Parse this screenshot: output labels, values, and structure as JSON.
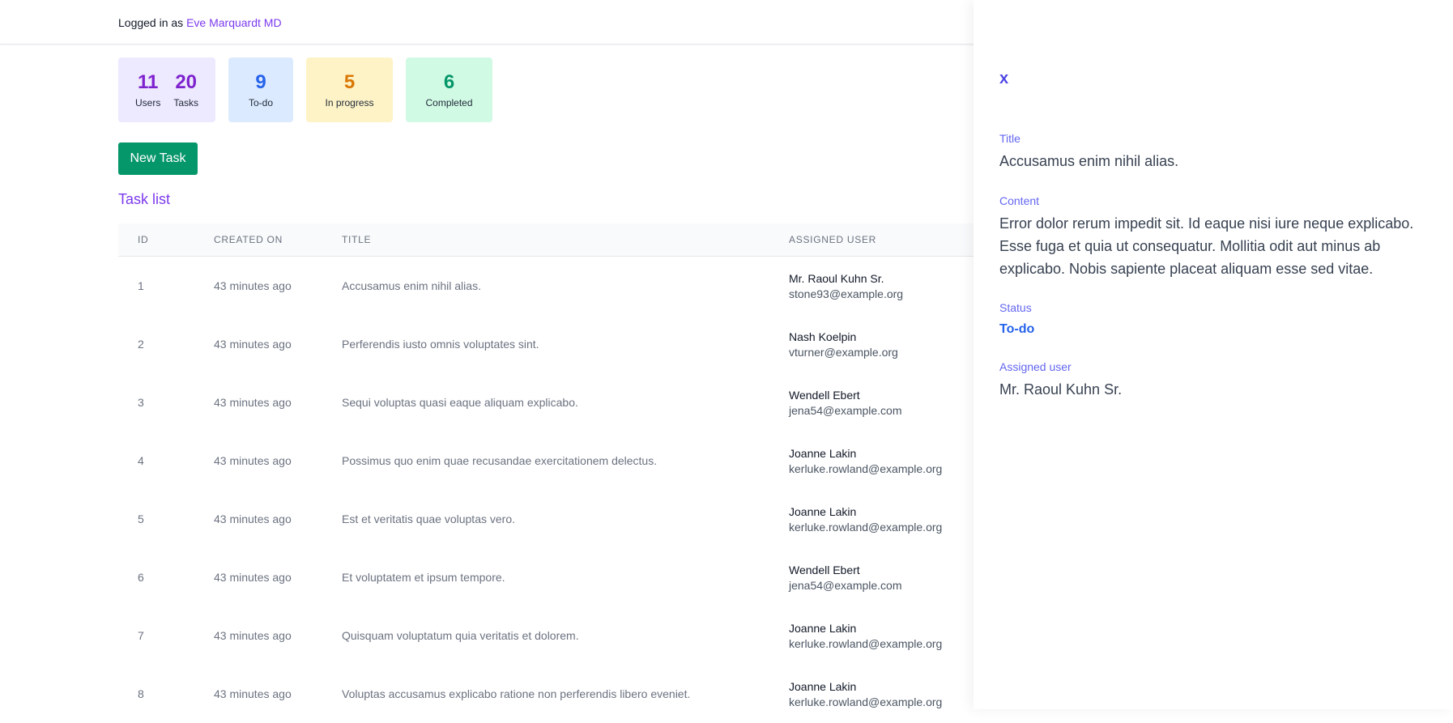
{
  "header": {
    "logged_in_prefix": "Logged in as ",
    "user_name": "Eve Marquardt MD"
  },
  "stats": {
    "users": {
      "value": "11",
      "label": "Users"
    },
    "tasks": {
      "value": "20",
      "label": "Tasks"
    },
    "todo": {
      "value": "9",
      "label": "To-do"
    },
    "in_progress": {
      "value": "5",
      "label": "In progress"
    },
    "completed": {
      "value": "6",
      "label": "Completed"
    }
  },
  "new_task_label": "New Task",
  "task_list_title": "Task list",
  "table": {
    "columns": [
      "ID",
      "CREATED ON",
      "TITLE",
      "ASSIGNED USER"
    ],
    "rows": [
      {
        "id": "1",
        "created": "43 minutes ago",
        "title": "Accusamus enim nihil alias.",
        "user_name": "Mr. Raoul Kuhn Sr.",
        "user_email": "stone93@example.org"
      },
      {
        "id": "2",
        "created": "43 minutes ago",
        "title": "Perferendis iusto omnis voluptates sint.",
        "user_name": "Nash Koelpin",
        "user_email": "vturner@example.org"
      },
      {
        "id": "3",
        "created": "43 minutes ago",
        "title": "Sequi voluptas quasi eaque aliquam explicabo.",
        "user_name": "Wendell Ebert",
        "user_email": "jena54@example.com"
      },
      {
        "id": "4",
        "created": "43 minutes ago",
        "title": "Possimus quo enim quae recusandae exercitationem delectus.",
        "user_name": "Joanne Lakin",
        "user_email": "kerluke.rowland@example.org"
      },
      {
        "id": "5",
        "created": "43 minutes ago",
        "title": "Est et veritatis quae voluptas vero.",
        "user_name": "Joanne Lakin",
        "user_email": "kerluke.rowland@example.org"
      },
      {
        "id": "6",
        "created": "43 minutes ago",
        "title": "Et voluptatem et ipsum tempore.",
        "user_name": "Wendell Ebert",
        "user_email": "jena54@example.com"
      },
      {
        "id": "7",
        "created": "43 minutes ago",
        "title": "Quisquam voluptatum quia veritatis et dolorem.",
        "user_name": "Joanne Lakin",
        "user_email": "kerluke.rowland@example.org"
      },
      {
        "id": "8",
        "created": "43 minutes ago",
        "title": "Voluptas accusamus explicabo ratione non perferendis libero eveniet.",
        "user_name": "Joanne Lakin",
        "user_email": "kerluke.rowland@example.org"
      }
    ]
  },
  "detail_panel": {
    "close_label": "x",
    "title_label": "Title",
    "title_value": "Accusamus enim nihil alias.",
    "content_label": "Content",
    "content_value": "Error dolor rerum impedit sit. Id eaque nisi iure neque explicabo. Esse fuga et quia ut consequatur. Mollitia odit aut minus ab explicabo. Nobis sapiente placeat aliquam esse sed vitae.",
    "status_label": "Status",
    "status_value": "To-do",
    "assigned_label": "Assigned user",
    "assigned_value": "Mr. Raoul Kuhn Sr."
  },
  "colors": {
    "accent": "#7c3aed",
    "new_task_button": "#059669",
    "status_todo": "#2563eb"
  }
}
